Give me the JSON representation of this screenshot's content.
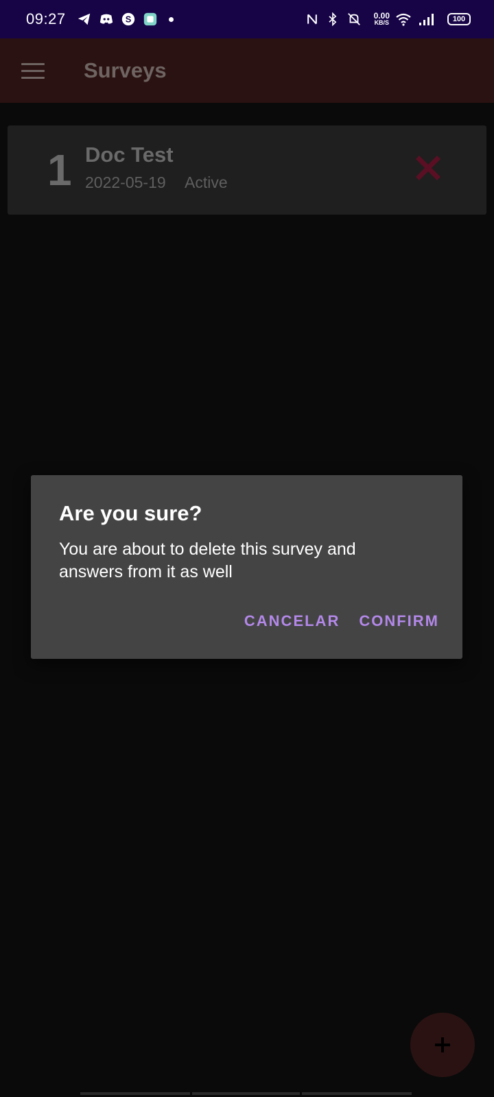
{
  "status_bar": {
    "time": "09:27",
    "net_speed_value": "0.00",
    "net_speed_unit": "KB/S",
    "battery": "100",
    "icons": [
      "telegram-icon",
      "discord-icon",
      "skype-icon",
      "app-icon",
      "notification-dot",
      "nfc-icon",
      "bluetooth-icon",
      "mute-icon",
      "wifi-icon",
      "signal-icon",
      "battery-icon"
    ]
  },
  "app_bar": {
    "title": "Surveys"
  },
  "surveys": [
    {
      "number": "1",
      "title": "Doc Test",
      "date": "2022-05-19",
      "status": "Active"
    }
  ],
  "dialog": {
    "title": "Are you sure?",
    "message": "You are about to delete this survey and answers from it as well",
    "cancel_label": "CANCELAR",
    "confirm_label": "CONFIRM"
  },
  "colors": {
    "status_bar": "#170447",
    "app_bar": "#2b1212",
    "dialog_bg": "#444444",
    "accent_button": "#b388e8",
    "delete_icon": "#5a0f24"
  }
}
